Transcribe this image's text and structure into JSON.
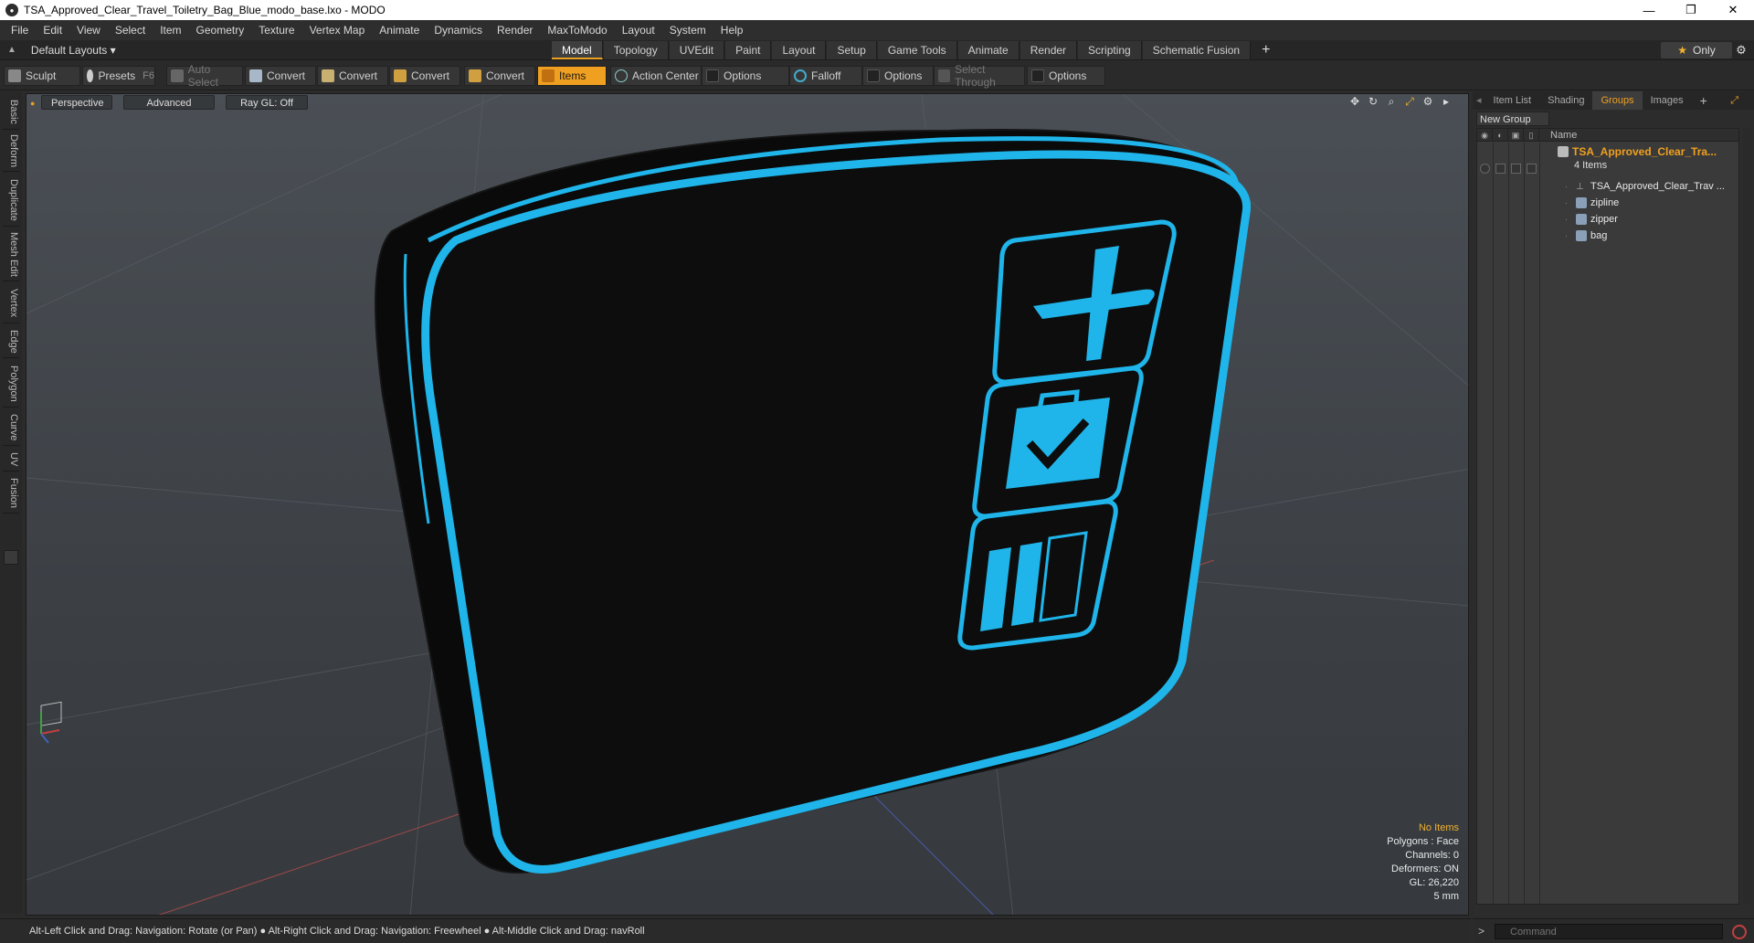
{
  "window": {
    "title": "TSA_Approved_Clear_Travel_Toiletry_Bag_Blue_modo_base.lxo - MODO",
    "minimize": "—",
    "maximize": "❐",
    "close": "✕"
  },
  "menu": [
    "File",
    "Edit",
    "View",
    "Select",
    "Item",
    "Geometry",
    "Texture",
    "Vertex Map",
    "Animate",
    "Dynamics",
    "Render",
    "MaxToModo",
    "Layout",
    "System",
    "Help"
  ],
  "layout_bar": {
    "layouts_label": "Default Layouts ▾",
    "tabs": [
      "Model",
      "Topology",
      "UVEdit",
      "Paint",
      "Layout",
      "Setup",
      "Game Tools",
      "Animate",
      "Render",
      "Scripting",
      "Schematic Fusion"
    ],
    "active_tab": "Model",
    "only_label": "Only"
  },
  "toolbar": {
    "sculpt": "Sculpt",
    "presets": "Presets",
    "presets_key": "F6",
    "auto_select": "Auto Select",
    "convert1": "Convert",
    "convert2": "Convert",
    "convert3": "Convert",
    "convert4": "Convert",
    "items": "Items",
    "action_center": "Action Center",
    "options1": "Options",
    "falloff": "Falloff",
    "options2": "Options",
    "select_through": "Select Through",
    "options3": "Options"
  },
  "left_tabs": [
    "Basic",
    "Deform",
    "Duplicate",
    "Mesh Edit",
    "Vertex",
    "Edge",
    "Polygon",
    "Curve",
    "UV",
    "Fusion"
  ],
  "viewport": {
    "view_mode": "Perspective",
    "shading": "Advanced",
    "raygl": "Ray GL: Off",
    "info": {
      "no_items": "No Items",
      "polygons": "Polygons : Face",
      "channels": "Channels: 0",
      "deformers": "Deformers: ON",
      "gl": "GL: 26,220",
      "unit": "5 mm"
    },
    "accent_color": "#1fb5ea"
  },
  "right_panel": {
    "tabs": [
      "Item List",
      "Shading",
      "Groups",
      "Images"
    ],
    "active_tab": "Groups",
    "new_group": "New Group",
    "column_name": "Name",
    "group": {
      "name": "TSA_Approved_Clear_Tra...",
      "count": "4 Items",
      "items": [
        "TSA_Approved_Clear_Trav ...",
        "zipline",
        "zipper",
        "bag"
      ]
    }
  },
  "status": {
    "hint": "Alt-Left Click and Drag: Navigation: Rotate (or Pan) ● Alt-Right Click and Drag: Navigation: Freewheel ● Alt-Middle Click and Drag: navRoll"
  },
  "command": {
    "placeholder": "Command"
  }
}
